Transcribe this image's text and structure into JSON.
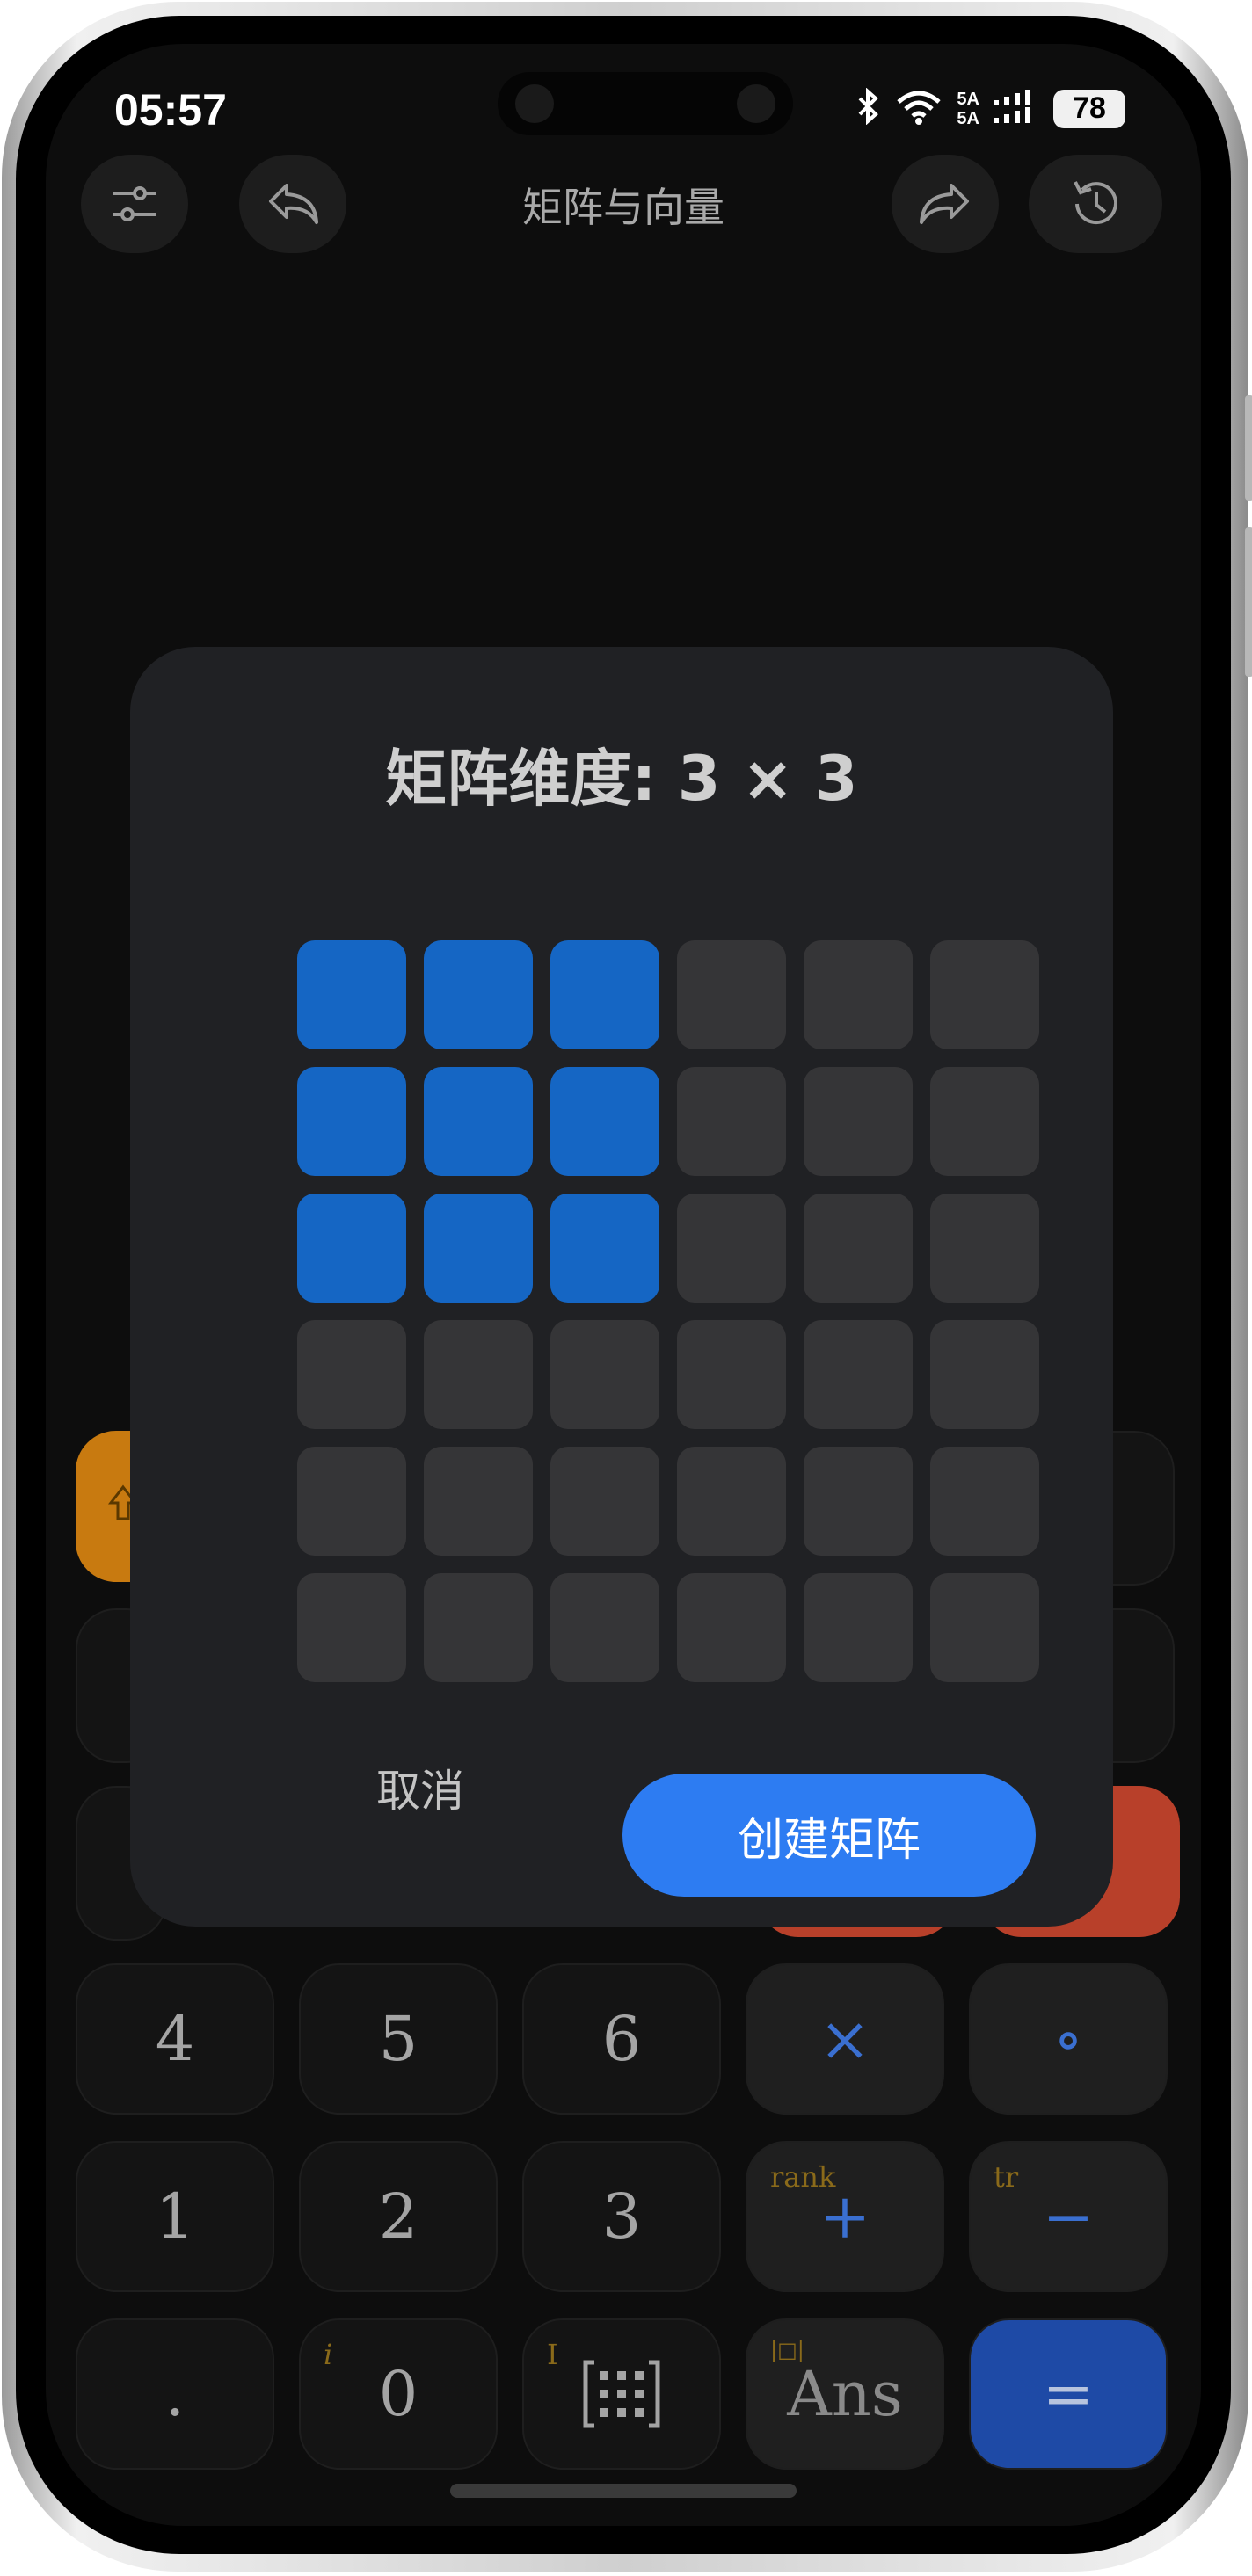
{
  "status": {
    "time": "05:57",
    "battery": "78",
    "signal1": "5A",
    "signal2": "5A"
  },
  "header": {
    "title": "矩阵与向量"
  },
  "dialog": {
    "title": "矩阵维度: 3 × 3",
    "rows_selected": 3,
    "cols_selected": 3,
    "grid_size": 6,
    "cancel_label": "取消",
    "create_label": "创建矩阵"
  },
  "keypad": {
    "row4": [
      "4",
      "5",
      "6",
      "×",
      "∘"
    ],
    "row5": [
      "1",
      "2",
      "3",
      "+",
      "−"
    ],
    "row6": [
      ".",
      "0",
      "",
      "Ans",
      "="
    ],
    "sup_rank": "rank",
    "sup_tr": "tr",
    "sup_i": "i",
    "sup_I": "I",
    "sup_abs": "|□|"
  },
  "colors": {
    "accent": "#2d7cf2",
    "selected_cell": "#1566c4",
    "cell": "#353537",
    "shift_key": "#c87a10",
    "clear_key": "#b8402a",
    "equals_key": "#1e4aa6"
  }
}
